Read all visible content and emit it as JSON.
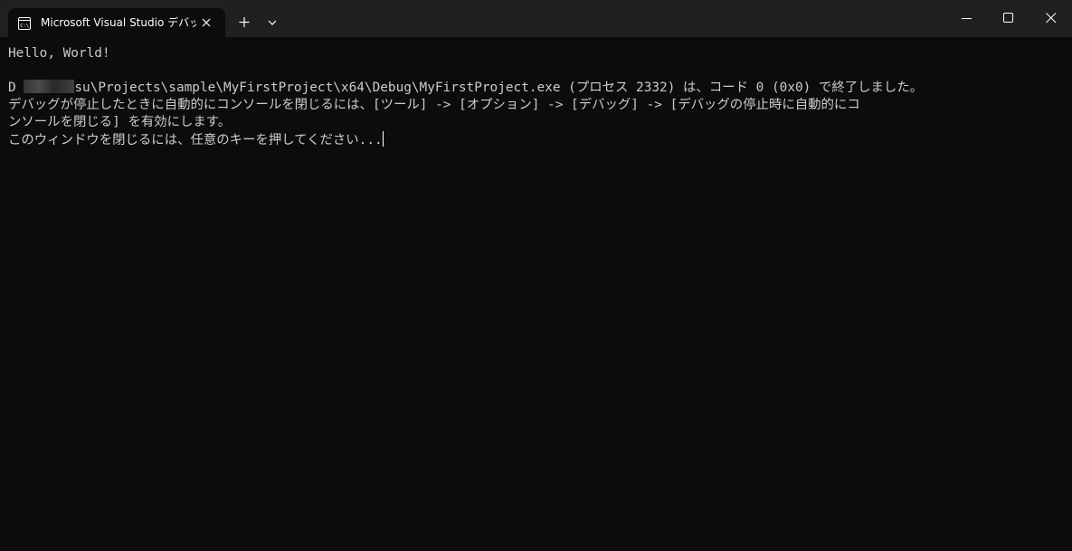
{
  "window": {
    "tab_title": "Microsoft Visual Studio デバッグ",
    "tab_icon": "console-app-icon",
    "new_tab_icon": "plus-icon",
    "dropdown_icon": "chevron-down-icon",
    "minimize_icon": "minimize-icon",
    "maximize_icon": "maximize-icon",
    "close_icon": "close-icon"
  },
  "console": {
    "line1": "Hello, World!",
    "line3_prefix": "D",
    "line3_suffix": "su\\Projects\\sample\\MyFirstProject\\x64\\Debug\\MyFirstProject.exe (プロセス 2332) は、コード 0 (0x0) で終了しました。",
    "line4": "デバッグが停止したときに自動的にコンソールを閉じるには、[ツール] -> [オプション] -> [デバッグ] -> [デバッグの停止時に自動的にコ",
    "line5": "ンソールを閉じる] を有効にします。",
    "line6": "このウィンドウを閉じるには、任意のキーを押してください..."
  },
  "colors": {
    "background": "#0c0c0c",
    "titlebar": "#202020",
    "text": "#cccccc"
  }
}
